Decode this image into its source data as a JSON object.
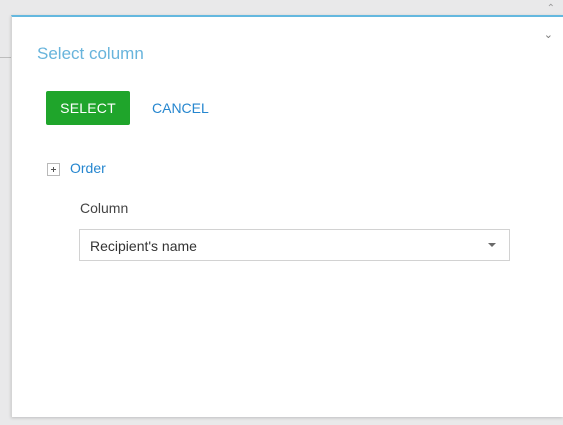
{
  "dialog": {
    "title": "Select column",
    "collapse_icon": "chevron-down-icon",
    "accent_color": "#64b8df"
  },
  "actions": {
    "select_label": "SELECT",
    "select_color": "#1fa52b",
    "cancel_label": "CANCEL",
    "link_color": "#2586cf"
  },
  "group": {
    "toggle_icon": "plus-icon",
    "title": "Order",
    "expanded": false
  },
  "column_field": {
    "label": "Column",
    "value": "Recipient's name",
    "dropdown_icon": "caret-down-icon"
  }
}
